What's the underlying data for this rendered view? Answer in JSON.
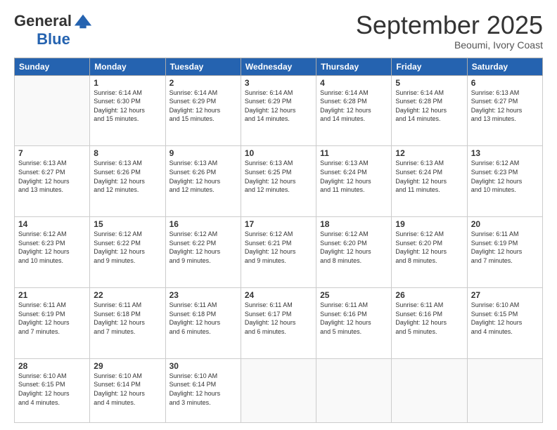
{
  "logo": {
    "general": "General",
    "blue": "Blue"
  },
  "header": {
    "month": "September 2025",
    "location": "Beoumi, Ivory Coast"
  },
  "weekdays": [
    "Sunday",
    "Monday",
    "Tuesday",
    "Wednesday",
    "Thursday",
    "Friday",
    "Saturday"
  ],
  "weeks": [
    [
      {
        "day": "",
        "info": ""
      },
      {
        "day": "1",
        "info": "Sunrise: 6:14 AM\nSunset: 6:30 PM\nDaylight: 12 hours\nand 15 minutes."
      },
      {
        "day": "2",
        "info": "Sunrise: 6:14 AM\nSunset: 6:29 PM\nDaylight: 12 hours\nand 15 minutes."
      },
      {
        "day": "3",
        "info": "Sunrise: 6:14 AM\nSunset: 6:29 PM\nDaylight: 12 hours\nand 14 minutes."
      },
      {
        "day": "4",
        "info": "Sunrise: 6:14 AM\nSunset: 6:28 PM\nDaylight: 12 hours\nand 14 minutes."
      },
      {
        "day": "5",
        "info": "Sunrise: 6:14 AM\nSunset: 6:28 PM\nDaylight: 12 hours\nand 14 minutes."
      },
      {
        "day": "6",
        "info": "Sunrise: 6:13 AM\nSunset: 6:27 PM\nDaylight: 12 hours\nand 13 minutes."
      }
    ],
    [
      {
        "day": "7",
        "info": "Sunrise: 6:13 AM\nSunset: 6:27 PM\nDaylight: 12 hours\nand 13 minutes."
      },
      {
        "day": "8",
        "info": "Sunrise: 6:13 AM\nSunset: 6:26 PM\nDaylight: 12 hours\nand 12 minutes."
      },
      {
        "day": "9",
        "info": "Sunrise: 6:13 AM\nSunset: 6:26 PM\nDaylight: 12 hours\nand 12 minutes."
      },
      {
        "day": "10",
        "info": "Sunrise: 6:13 AM\nSunset: 6:25 PM\nDaylight: 12 hours\nand 12 minutes."
      },
      {
        "day": "11",
        "info": "Sunrise: 6:13 AM\nSunset: 6:24 PM\nDaylight: 12 hours\nand 11 minutes."
      },
      {
        "day": "12",
        "info": "Sunrise: 6:13 AM\nSunset: 6:24 PM\nDaylight: 12 hours\nand 11 minutes."
      },
      {
        "day": "13",
        "info": "Sunrise: 6:12 AM\nSunset: 6:23 PM\nDaylight: 12 hours\nand 10 minutes."
      }
    ],
    [
      {
        "day": "14",
        "info": "Sunrise: 6:12 AM\nSunset: 6:23 PM\nDaylight: 12 hours\nand 10 minutes."
      },
      {
        "day": "15",
        "info": "Sunrise: 6:12 AM\nSunset: 6:22 PM\nDaylight: 12 hours\nand 9 minutes."
      },
      {
        "day": "16",
        "info": "Sunrise: 6:12 AM\nSunset: 6:22 PM\nDaylight: 12 hours\nand 9 minutes."
      },
      {
        "day": "17",
        "info": "Sunrise: 6:12 AM\nSunset: 6:21 PM\nDaylight: 12 hours\nand 9 minutes."
      },
      {
        "day": "18",
        "info": "Sunrise: 6:12 AM\nSunset: 6:20 PM\nDaylight: 12 hours\nand 8 minutes."
      },
      {
        "day": "19",
        "info": "Sunrise: 6:12 AM\nSunset: 6:20 PM\nDaylight: 12 hours\nand 8 minutes."
      },
      {
        "day": "20",
        "info": "Sunrise: 6:11 AM\nSunset: 6:19 PM\nDaylight: 12 hours\nand 7 minutes."
      }
    ],
    [
      {
        "day": "21",
        "info": "Sunrise: 6:11 AM\nSunset: 6:19 PM\nDaylight: 12 hours\nand 7 minutes."
      },
      {
        "day": "22",
        "info": "Sunrise: 6:11 AM\nSunset: 6:18 PM\nDaylight: 12 hours\nand 7 minutes."
      },
      {
        "day": "23",
        "info": "Sunrise: 6:11 AM\nSunset: 6:18 PM\nDaylight: 12 hours\nand 6 minutes."
      },
      {
        "day": "24",
        "info": "Sunrise: 6:11 AM\nSunset: 6:17 PM\nDaylight: 12 hours\nand 6 minutes."
      },
      {
        "day": "25",
        "info": "Sunrise: 6:11 AM\nSunset: 6:16 PM\nDaylight: 12 hours\nand 5 minutes."
      },
      {
        "day": "26",
        "info": "Sunrise: 6:11 AM\nSunset: 6:16 PM\nDaylight: 12 hours\nand 5 minutes."
      },
      {
        "day": "27",
        "info": "Sunrise: 6:10 AM\nSunset: 6:15 PM\nDaylight: 12 hours\nand 4 minutes."
      }
    ],
    [
      {
        "day": "28",
        "info": "Sunrise: 6:10 AM\nSunset: 6:15 PM\nDaylight: 12 hours\nand 4 minutes."
      },
      {
        "day": "29",
        "info": "Sunrise: 6:10 AM\nSunset: 6:14 PM\nDaylight: 12 hours\nand 4 minutes."
      },
      {
        "day": "30",
        "info": "Sunrise: 6:10 AM\nSunset: 6:14 PM\nDaylight: 12 hours\nand 3 minutes."
      },
      {
        "day": "",
        "info": ""
      },
      {
        "day": "",
        "info": ""
      },
      {
        "day": "",
        "info": ""
      },
      {
        "day": "",
        "info": ""
      }
    ]
  ]
}
